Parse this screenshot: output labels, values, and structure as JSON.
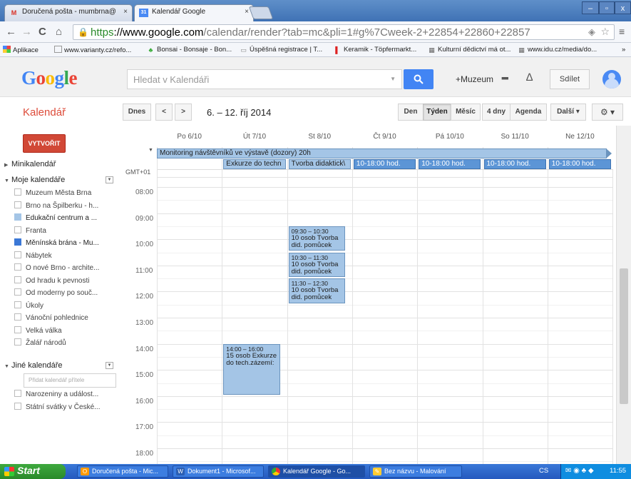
{
  "browser": {
    "tabs": [
      {
        "label": "Doručená pošta - mumbrna@",
        "icon": "gmail-icon",
        "close": "×"
      },
      {
        "label": "Kalendář Google",
        "icon": "calendar-icon",
        "close": "×"
      }
    ],
    "window_controls": {
      "minimize": "–",
      "maximize": "▫",
      "close": "x"
    },
    "nav": {
      "back": "←",
      "forward": "→",
      "reload": "C",
      "home": "⌂"
    },
    "url": {
      "https": "https",
      "host": "://www.google.com",
      "rest": "/calendar/render?tab=mc&pli=1#g%7Cweek-2+22854+22860+22857"
    },
    "bookmarks": [
      "Aplikace",
      "www.varianty.cz/refo...",
      "Bonsai - Bonsaje - Bon...",
      "Úspěšná registrace | T...",
      "Keramik - Töpfermarkt...",
      "Kulturní dědictví má ot...",
      "www.idu.cz/media/do..."
    ],
    "more_bookmarks": "»"
  },
  "google": {
    "logo": "Google",
    "search_placeholder": "Hledat v Kalendáři",
    "search_btn_icon": "search-icon",
    "profile_name": "+Muzeum",
    "share_label": "Sdílet"
  },
  "toolbar": {
    "calendar_title": "Kalendář",
    "today": "Dnes",
    "prev": "<",
    "next": ">",
    "date_range": "6. – 12. říj 2014",
    "views": [
      "Den",
      "Týden",
      "Měsíc",
      "4 dny",
      "Agenda"
    ],
    "selected_view": "Týden",
    "more": "Další ▾",
    "settings": "⚙ ▾"
  },
  "sidebar": {
    "create": "VYTVOŘIT",
    "minicalendar": "Minikalendář",
    "my_calendars_title": "Moje kalendáře",
    "my_calendars": [
      {
        "name": "Muzeum Města Brna",
        "color": "",
        "checked": false
      },
      {
        "name": "Brno na Špilberku - h...",
        "color": "",
        "checked": false
      },
      {
        "name": "Edukační centrum a ...",
        "color": "#a4c5e6",
        "checked": true
      },
      {
        "name": "Franta",
        "color": "",
        "checked": false
      },
      {
        "name": "Měnínská brána - Mu...",
        "color": "#3b78d6",
        "checked": true
      },
      {
        "name": "Nábytek",
        "color": "",
        "checked": false
      },
      {
        "name": "O nové Brno - archite...",
        "color": "",
        "checked": false
      },
      {
        "name": "Od hradu k pevnosti",
        "color": "",
        "checked": false
      },
      {
        "name": "Od moderny po souč...",
        "color": "",
        "checked": false
      },
      {
        "name": "Úkoly",
        "color": "",
        "checked": false
      },
      {
        "name": "Vánoční pohlednice",
        "color": "",
        "checked": false
      },
      {
        "name": "Velká válka",
        "color": "",
        "checked": false
      },
      {
        "name": "Žalář národů",
        "color": "",
        "checked": false
      }
    ],
    "other_calendars_title": "Jiné kalendáře",
    "add_friend_placeholder": "Přidat kalendář přítele",
    "other_calendars": [
      {
        "name": "Narozeniny a událost...",
        "checked": false
      },
      {
        "name": "Státní svátky v České...",
        "checked": false
      }
    ]
  },
  "calendar": {
    "timezone": "GMT+01",
    "days": [
      "Po 6/10",
      "Út 7/10",
      "St 8/10",
      "Čt 9/10",
      "Pá 10/10",
      "So 11/10",
      "Ne 12/10"
    ],
    "hours": [
      "08:00",
      "09:00",
      "10:00",
      "11:00",
      "12:00",
      "13:00",
      "14:00",
      "15:00",
      "16:00",
      "17:00",
      "18:00"
    ],
    "allday_events": [
      {
        "title": "Monitoring návštěvníků ve výstavě (dozory) 20h",
        "style": "light"
      },
      {
        "title": "Exkurze do techn",
        "style": "light"
      },
      {
        "title": "Tvorba didaktick\\",
        "style": "light"
      },
      {
        "title": "10-18:00 hod.",
        "style": "dark"
      },
      {
        "title": "10-18:00 hod.",
        "style": "dark"
      },
      {
        "title": "10-18:00 hod.",
        "style": "dark"
      },
      {
        "title": "10-18:00 hod.",
        "style": "dark"
      }
    ],
    "timed_events": [
      {
        "time": "09:30 – 10:30",
        "title": "10 osob Tvorba did. pomůcek"
      },
      {
        "time": "10:30 – 11:30",
        "title": "10 osob Tvorba did. pomůcek"
      },
      {
        "time": "11:30 – 12:30",
        "title": "10 osob Tvorba did. pomůcek"
      },
      {
        "time": "14:00 – 16:00",
        "title": "15 osob Exkurze do tech.zázemí:"
      }
    ]
  },
  "taskbar": {
    "start": "Start",
    "tasks": [
      "Doručená pošta - Mic...",
      "Dokument1 - Microsof...",
      "Kalendář Google - Go...",
      "Bez názvu - Malování"
    ],
    "lang": "CS",
    "clock": "11:55"
  }
}
